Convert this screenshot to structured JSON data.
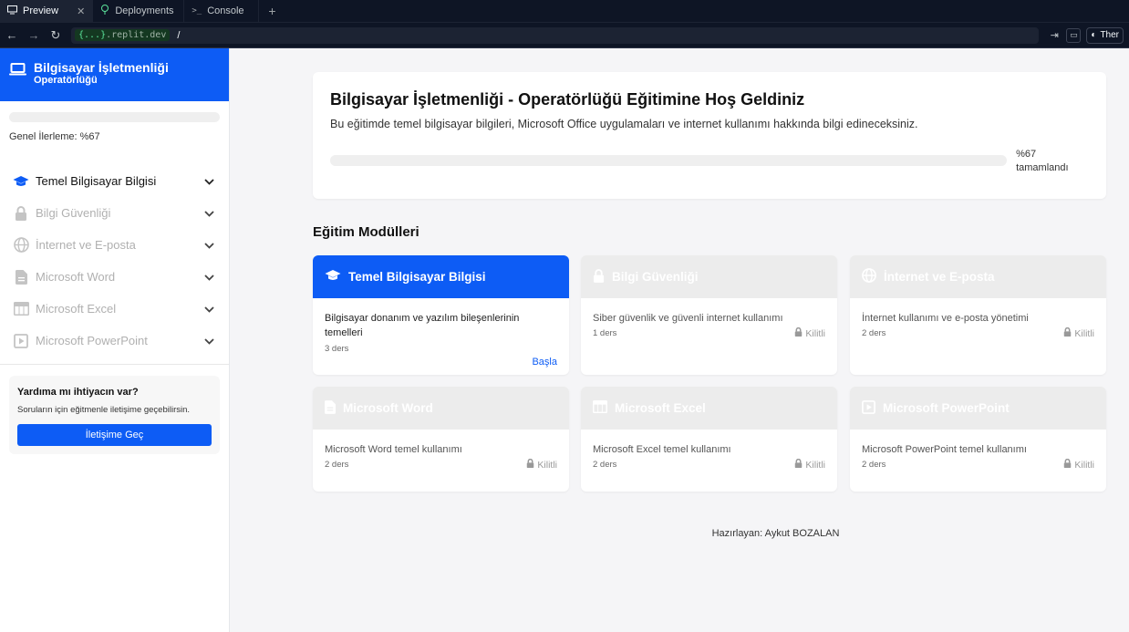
{
  "browser": {
    "tabs": [
      {
        "label": "Preview",
        "icon": "monitor-icon",
        "active": true
      },
      {
        "label": "Deployments",
        "icon": "tree-icon",
        "active": false
      },
      {
        "label": "Console",
        "icon": "terminal-icon",
        "active": false
      }
    ],
    "url_domain": ".replit.dev",
    "url_prefix": "{...}",
    "url_path": "/",
    "theme_label": "Ther"
  },
  "sidebar": {
    "title": "Bilgisayar İşletmenliği",
    "subtitle": "Operatörlüğü",
    "progress_text": "Genel İlerleme: %67",
    "progress_percent": 67,
    "items": [
      {
        "label": "Temel Bilgisayar Bilgisi",
        "icon": "graduation-cap-icon",
        "active": true
      },
      {
        "label": "Bilgi Güvenliği",
        "icon": "lock-icon",
        "active": false
      },
      {
        "label": "İnternet ve E-posta",
        "icon": "globe-icon",
        "active": false
      },
      {
        "label": "Microsoft Word",
        "icon": "document-icon",
        "active": false
      },
      {
        "label": "Microsoft Excel",
        "icon": "table-icon",
        "active": false
      },
      {
        "label": "Microsoft PowerPoint",
        "icon": "slideshow-icon",
        "active": false
      }
    ],
    "help": {
      "title": "Yardıma mı ihtiyacın var?",
      "text": "Soruların için eğitmenle iletişime geçebilirsin.",
      "button": "İletişime Geç"
    }
  },
  "welcome": {
    "title": "Bilgisayar İşletmenliği - Operatörlüğü Eğitimine Hoş Geldiniz",
    "description": "Bu eğitimde temel bilgisayar bilgileri, Microsoft Office uygulamaları ve internet kullanımı hakkında bilgi edineceksiniz.",
    "progress_percent": 67,
    "progress_value": "%67",
    "progress_caption": "tamamlandı"
  },
  "modules": {
    "title": "Eğitim Modülleri",
    "cards": [
      {
        "title": "Temel Bilgisayar Bilgisi",
        "icon": "graduation-cap-icon",
        "description": "Bilgisayar donanım ve yazılım bileşenlerinin temelleri",
        "lessons": "3 ders",
        "action": "Başla",
        "locked": false
      },
      {
        "title": "Bilgi Güvenliği",
        "icon": "lock-icon",
        "description": "Siber güvenlik ve güvenli internet kullanımı",
        "lessons": "1 ders",
        "action": "Kilitli",
        "locked": true
      },
      {
        "title": "İnternet ve E-posta",
        "icon": "globe-icon",
        "description": "İnternet kullanımı ve e-posta yönetimi",
        "lessons": "2 ders",
        "action": "Kilitli",
        "locked": true
      },
      {
        "title": "Microsoft Word",
        "icon": "document-icon",
        "description": "Microsoft Word temel kullanımı",
        "lessons": "2 ders",
        "action": "Kilitli",
        "locked": true
      },
      {
        "title": "Microsoft Excel",
        "icon": "table-icon",
        "description": "Microsoft Excel temel kullanımı",
        "lessons": "2 ders",
        "action": "Kilitli",
        "locked": true
      },
      {
        "title": "Microsoft PowerPoint",
        "icon": "slideshow-icon",
        "description": "Microsoft PowerPoint temel kullanımı",
        "lessons": "2 ders",
        "action": "Kilitli",
        "locked": true
      }
    ]
  },
  "footer": {
    "text": "Hazırlayan: Aykut BOZALAN"
  },
  "colors": {
    "primary": "#0d5cf5",
    "locked_header": "#ececec"
  }
}
